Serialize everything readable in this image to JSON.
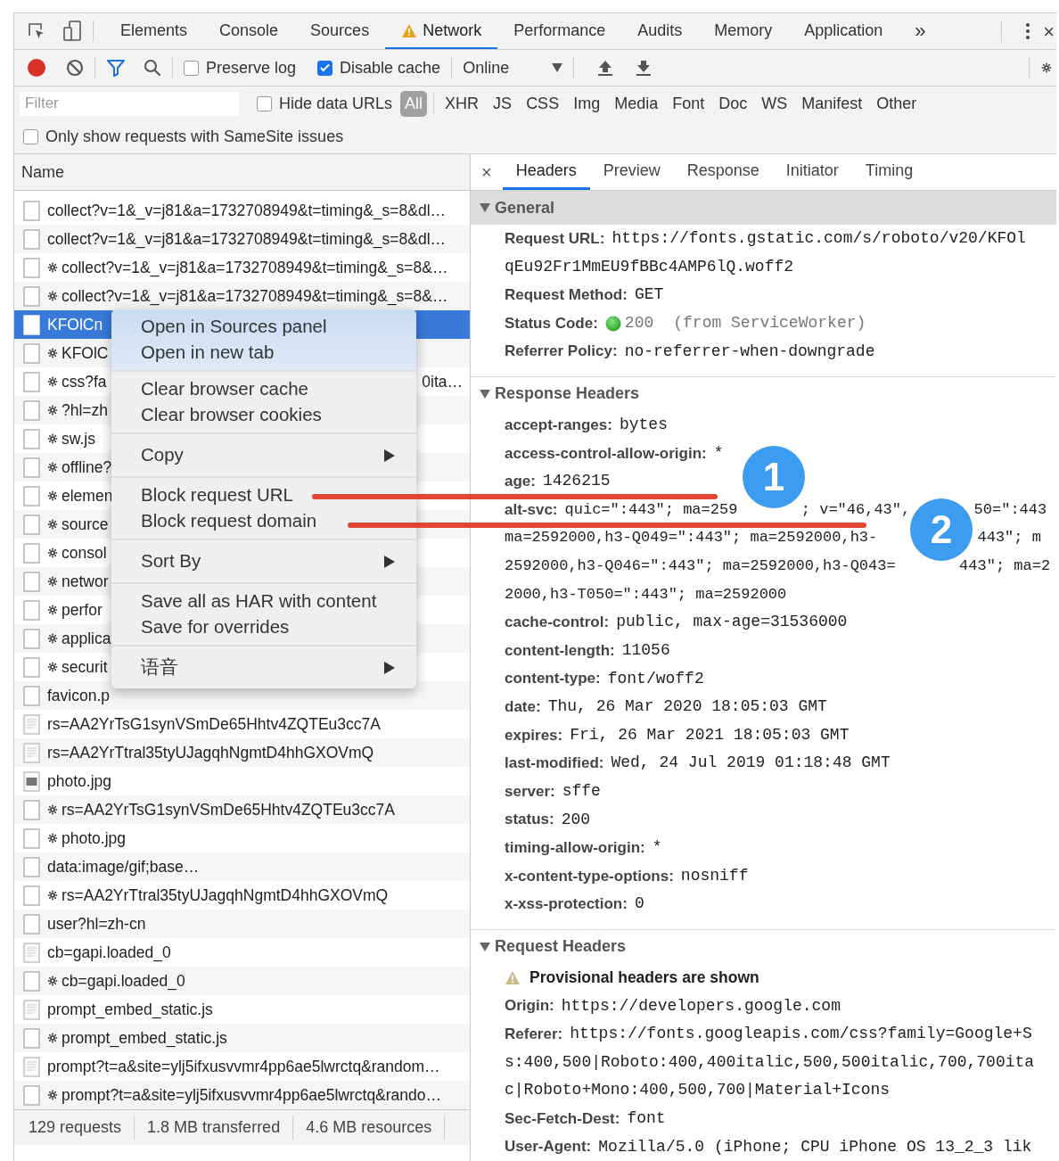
{
  "tabs_bar": {
    "tabs": [
      {
        "label": "Elements",
        "selected": false,
        "warning": false
      },
      {
        "label": "Console",
        "selected": false,
        "warning": false
      },
      {
        "label": "Sources",
        "selected": false,
        "warning": false
      },
      {
        "label": "Network",
        "selected": true,
        "warning": true
      },
      {
        "label": "Performance",
        "selected": false,
        "warning": false
      },
      {
        "label": "Audits",
        "selected": false,
        "warning": false
      },
      {
        "label": "Memory",
        "selected": false,
        "warning": false
      },
      {
        "label": "Application",
        "selected": false,
        "warning": false
      }
    ],
    "more": "»",
    "close": "×"
  },
  "toolbar": {
    "recording": true,
    "filter_active": true,
    "checkboxes": [
      {
        "label": "Preserve log",
        "checked": false
      },
      {
        "label": "Disable cache",
        "checked": true
      }
    ],
    "throttling": "Online"
  },
  "filter_bar": {
    "placeholder": "Filter",
    "hide_data_urls": {
      "label": "Hide data URLs",
      "checked": false
    },
    "types": [
      {
        "label": "All",
        "selected": true
      },
      {
        "label": "XHR",
        "selected": false
      },
      {
        "label": "JS",
        "selected": false
      },
      {
        "label": "CSS",
        "selected": false
      },
      {
        "label": "Img",
        "selected": false
      },
      {
        "label": "Media",
        "selected": false
      },
      {
        "label": "Font",
        "selected": false
      },
      {
        "label": "Doc",
        "selected": false
      },
      {
        "label": "WS",
        "selected": false
      },
      {
        "label": "Manifest",
        "selected": false
      },
      {
        "label": "Other",
        "selected": false
      }
    ]
  },
  "samesite": {
    "label": "Only show requests with SameSite issues",
    "checked": false
  },
  "requests": {
    "column": "Name",
    "rows": [
      {
        "name": "collect?v=1&_v=j81&a=1732708949&t=timing&_s=8&dl…",
        "kind": "blank",
        "service_worker": false,
        "selected": false
      },
      {
        "name": "collect?v=1&_v=j81&a=1732708949&t=timing&_s=8&dl…",
        "kind": "blank",
        "service_worker": false,
        "selected": false
      },
      {
        "name": "collect?v=1&_v=j81&a=1732708949&t=timing&_s=8&…",
        "kind": "blank",
        "service_worker": true,
        "selected": false
      },
      {
        "name": "collect?v=1&_v=j81&a=1732708949&t=timing&_s=8&…",
        "kind": "blank",
        "service_worker": true,
        "selected": false
      },
      {
        "name": "KFOlCn",
        "kind": "blank",
        "service_worker": false,
        "selected": true
      },
      {
        "name": "KFOlC",
        "kind": "blank",
        "service_worker": true,
        "selected": false
      },
      {
        "name": "css?fa",
        "tail": "0ita…",
        "kind": "blank",
        "service_worker": true,
        "selected": false
      },
      {
        "name": "?hl=zh",
        "kind": "blank",
        "service_worker": true,
        "selected": false
      },
      {
        "name": "sw.js",
        "kind": "blank",
        "service_worker": true,
        "selected": false
      },
      {
        "name": "offline?",
        "kind": "blank",
        "service_worker": true,
        "selected": false
      },
      {
        "name": "elemen",
        "kind": "blank",
        "service_worker": true,
        "selected": false
      },
      {
        "name": "source",
        "kind": "blank",
        "service_worker": true,
        "selected": false
      },
      {
        "name": "consol",
        "kind": "blank",
        "service_worker": true,
        "selected": false
      },
      {
        "name": "networ",
        "kind": "blank",
        "service_worker": true,
        "selected": false
      },
      {
        "name": "perfor",
        "kind": "blank",
        "service_worker": true,
        "selected": false
      },
      {
        "name": "applica",
        "kind": "blank",
        "service_worker": true,
        "selected": false
      },
      {
        "name": "securit",
        "kind": "blank",
        "service_worker": true,
        "selected": false
      },
      {
        "name": "favicon.p",
        "kind": "blank",
        "service_worker": false,
        "selected": false
      },
      {
        "name": "rs=AA2YrTsG1synVSmDe65Hhtv4ZQTEu3cc7A",
        "kind": "document",
        "service_worker": false,
        "selected": false
      },
      {
        "name": "rs=AA2YrTtral35tyUJagqhNgmtD4hhGXOVmQ",
        "kind": "document",
        "service_worker": false,
        "selected": false
      },
      {
        "name": "photo.jpg",
        "kind": "image",
        "service_worker": false,
        "selected": false
      },
      {
        "name": "rs=AA2YrTsG1synVSmDe65Hhtv4ZQTEu3cc7A",
        "kind": "blank",
        "service_worker": true,
        "selected": false
      },
      {
        "name": "photo.jpg",
        "kind": "blank",
        "service_worker": true,
        "selected": false
      },
      {
        "name": "data:image/gif;base…",
        "kind": "blank",
        "service_worker": false,
        "selected": false
      },
      {
        "name": "rs=AA2YrTtral35tyUJagqhNgmtD4hhGXOVmQ",
        "kind": "blank",
        "service_worker": true,
        "selected": false
      },
      {
        "name": "user?hl=zh-cn",
        "kind": "blank",
        "service_worker": false,
        "selected": false
      },
      {
        "name": "cb=gapi.loaded_0",
        "kind": "document",
        "service_worker": false,
        "selected": false
      },
      {
        "name": "cb=gapi.loaded_0",
        "kind": "blank",
        "service_worker": true,
        "selected": false
      },
      {
        "name": "prompt_embed_static.js",
        "kind": "document",
        "service_worker": false,
        "selected": false
      },
      {
        "name": "prompt_embed_static.js",
        "kind": "blank",
        "service_worker": true,
        "selected": false
      },
      {
        "name": "prompt?t=a&site=ylj5ifxusvvmr4pp6ae5lwrctq&random…",
        "kind": "document",
        "service_worker": false,
        "selected": false
      },
      {
        "name": "prompt?t=a&site=ylj5ifxusvvmr4pp6ae5lwrctq&rando…",
        "kind": "blank",
        "service_worker": true,
        "selected": false
      }
    ]
  },
  "status_bar": [
    "129 requests",
    "1.8 MB transferred",
    "4.6 MB resources"
  ],
  "context_menu": {
    "groups": [
      {
        "highlighted": true,
        "items": [
          {
            "label": "Open in Sources panel",
            "submenu": false
          },
          {
            "label": "Open in new tab",
            "submenu": false
          }
        ]
      },
      {
        "highlighted": false,
        "items": [
          {
            "label": "Clear browser cache",
            "submenu": false
          },
          {
            "label": "Clear browser cookies",
            "submenu": false
          }
        ]
      },
      {
        "highlighted": false,
        "items": [
          {
            "label": "Copy",
            "submenu": true
          }
        ]
      },
      {
        "highlighted": false,
        "items": [
          {
            "label": "Block request URL",
            "submenu": false
          },
          {
            "label": "Block request domain",
            "submenu": false
          }
        ]
      },
      {
        "highlighted": false,
        "items": [
          {
            "label": "Sort By",
            "submenu": true
          }
        ]
      },
      {
        "highlighted": false,
        "items": [
          {
            "label": "Save all as HAR with content",
            "submenu": false
          },
          {
            "label": "Save for overrides",
            "submenu": false
          }
        ]
      },
      {
        "highlighted": false,
        "items": [
          {
            "label": "语音",
            "submenu": true
          }
        ]
      }
    ]
  },
  "details": {
    "close": "×",
    "tabs": [
      {
        "label": "Headers",
        "selected": true
      },
      {
        "label": "Preview",
        "selected": false
      },
      {
        "label": "Response",
        "selected": false
      },
      {
        "label": "Initiator",
        "selected": false
      },
      {
        "label": "Timing",
        "selected": false
      }
    ],
    "sections": [
      {
        "title": "General",
        "expanded": true,
        "highlighted": true,
        "items": [
          {
            "kind": "header",
            "name": "Request URL:",
            "lines": [
              "https://fonts.gstatic.com/s/roboto/v20/KFOl",
              "qEu92Fr1MmEU9fBBc4AMP6lQ.woff2"
            ]
          },
          {
            "kind": "header",
            "name": "Request Method:",
            "lines": [
              "GET"
            ]
          },
          {
            "kind": "status",
            "name": "Status Code:",
            "lines": [
              "200"
            ],
            "note": "(from ServiceWorker)"
          },
          {
            "kind": "header",
            "name": "Referrer Policy:",
            "lines": [
              "no-referrer-when-downgrade"
            ]
          }
        ]
      },
      {
        "title": "Response Headers",
        "expanded": true,
        "highlighted": false,
        "items": [
          {
            "kind": "header",
            "name": "accept-ranges:",
            "lines": [
              "bytes"
            ]
          },
          {
            "kind": "header",
            "name": "access-control-allow-origin:",
            "lines": [
              "*"
            ]
          },
          {
            "kind": "header",
            "name": "age:",
            "lines": [
              "1426215"
            ]
          },
          {
            "kind": "header",
            "name": "alt-svc:",
            "lines": [
              [
                "quic=\":443\"; ma=259",
                "; v=\"46,43\",",
                "50=\":443"
              ],
              [
                "ma=2592000,h3-Q049=\":443\"; ma=2592000,h3-",
                "443\"; m"
              ],
              [
                "2592000,h3-Q046=\":443\"; ma=2592000,h3-Q043=",
                "443\"; ma=2"
              ],
              "2000,h3-T050=\":443\"; ma=2592000"
            ]
          },
          {
            "kind": "header",
            "name": "cache-control:",
            "lines": [
              "public, max-age=31536000"
            ]
          },
          {
            "kind": "header",
            "name": "content-length:",
            "lines": [
              "11056"
            ]
          },
          {
            "kind": "header",
            "name": "content-type:",
            "lines": [
              "font/woff2"
            ]
          },
          {
            "kind": "header",
            "name": "date:",
            "lines": [
              "Thu, 26 Mar 2020 18:05:03 GMT"
            ]
          },
          {
            "kind": "header",
            "name": "expires:",
            "lines": [
              "Fri, 26 Mar 2021 18:05:03 GMT"
            ]
          },
          {
            "kind": "header",
            "name": "last-modified:",
            "lines": [
              "Wed, 24 Jul 2019 01:18:48 GMT"
            ]
          },
          {
            "kind": "header",
            "name": "server:",
            "lines": [
              "sffe"
            ]
          },
          {
            "kind": "header",
            "name": "status:",
            "lines": [
              "200"
            ]
          },
          {
            "kind": "header",
            "name": "timing-allow-origin:",
            "lines": [
              "*"
            ]
          },
          {
            "kind": "header",
            "name": "x-content-type-options:",
            "lines": [
              "nosniff"
            ]
          },
          {
            "kind": "header",
            "name": "x-xss-protection:",
            "lines": [
              "0"
            ]
          }
        ]
      },
      {
        "title": "Request Headers",
        "expanded": true,
        "highlighted": false,
        "items": [
          {
            "kind": "warning",
            "name": "Provisional headers are shown"
          },
          {
            "kind": "header",
            "name": "Origin:",
            "lines": [
              "https://developers.google.com"
            ]
          },
          {
            "kind": "header",
            "name": "Referer:",
            "lines": [
              "https://fonts.googleapis.com/css?family=Google+S",
              "s:400,500|Roboto:400,400italic,500,500italic,700,700ita",
              "c|Roboto+Mono:400,500,700|Material+Icons"
            ]
          },
          {
            "kind": "header",
            "name": "Sec-Fetch-Dest:",
            "lines": [
              "font"
            ]
          },
          {
            "kind": "header",
            "name": "User-Agent:",
            "lines": [
              "Mozilla/5.0 (iPhone; CPU iPhone OS 13_2_3 lik"
            ]
          }
        ]
      }
    ]
  },
  "annotations": [
    {
      "label": "1"
    },
    {
      "label": "2"
    }
  ]
}
